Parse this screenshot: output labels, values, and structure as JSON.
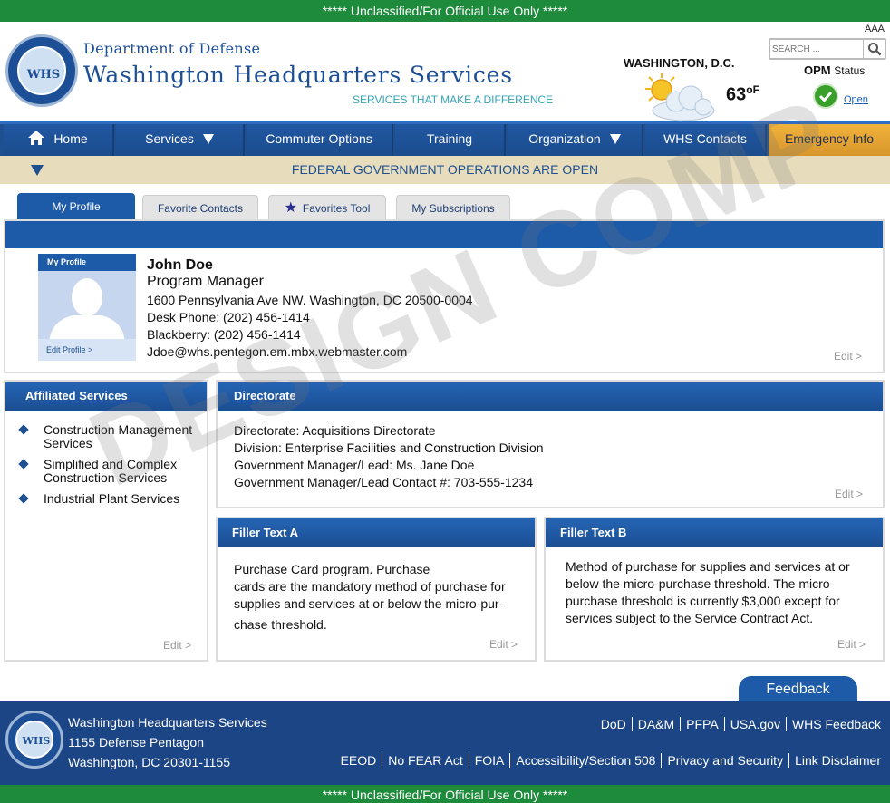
{
  "banner": {
    "top": "***** Unclassified/For Official Use Only *****",
    "bottom": "***** Unclassified/For Official Use Only *****"
  },
  "header": {
    "seal_text": "WHS",
    "dept": "Department of Defense",
    "agency": "Washington Headquarters Services",
    "tagline": "SERVICES THAT MAKE A DIFFERENCE",
    "text_size_label": "AAA",
    "search_placeholder": "SEARCH ...",
    "city": "WASHINGTON, D.C.",
    "temperature": "63",
    "temp_unit": "oF",
    "opm_label": "OPM",
    "opm_status": "Status",
    "opm_open": "Open"
  },
  "nav": {
    "items": [
      {
        "label": "Home"
      },
      {
        "label": "Services"
      },
      {
        "label": "Commuter Options"
      },
      {
        "label": "Training"
      },
      {
        "label": "Organization"
      },
      {
        "label": "WHS Contacts"
      },
      {
        "label": "Emergency Info"
      }
    ]
  },
  "status": {
    "message": "FEDERAL GOVERNMENT OPERATIONS ARE OPEN"
  },
  "tabs": [
    {
      "label": "My Profile"
    },
    {
      "label": "Favorite Contacts"
    },
    {
      "label": "Favorites Tool"
    },
    {
      "label": "My Subscriptions"
    }
  ],
  "profile": {
    "avatar_label": "My Profile",
    "edit_profile": "Edit Profile >",
    "name": "John Doe",
    "title": "Program Manager",
    "address": "1600 Pennsylvania Ave NW. Washington, DC 20500-0004",
    "desk_phone": "Desk Phone: (202) 456-1414",
    "blackberry": "Blackberry: (202) 456-1414",
    "email": "Jdoe@whs.pentegon.em.mbx.webmaster.com",
    "edit": "Edit >"
  },
  "affiliated": {
    "title": "Affiliated Services",
    "items": [
      "Construction Management Services",
      "Simplified and Complex Construction Services",
      "Industrial Plant Services"
    ],
    "edit": "Edit >"
  },
  "directorate": {
    "title": "Directorate",
    "lines": [
      "Directorate: Acquisitions Directorate",
      "Division: Enterprise Facilities and Construction Division",
      "Government Manager/Lead:  Ms. Jane Doe",
      "Government Manager/Lead Contact #: 703-555-1234"
    ],
    "edit": "Edit >"
  },
  "filler_a": {
    "title": "Filler Text A",
    "lines": [
      "Purchase Card program. Purchase",
      "cards are the mandatory method of purchase for",
      "supplies and services at or below the micro-pur-",
      "chase threshold."
    ],
    "edit": "Edit >"
  },
  "filler_b": {
    "title": "Filler Text B",
    "lines": [
      "Method of purchase for supplies and services at or",
      "below the micro-purchase threshold.  The micro-",
      "purchase threshold is currently $3,000 except for",
      "services subject to  the Service Contract Act."
    ],
    "edit": "Edit >"
  },
  "feedback": {
    "label": "Feedback"
  },
  "footer": {
    "seal_text": "WHS",
    "org": "Washington Headquarters Services",
    "street": "1155 Defense Pentagon",
    "city": "Washington, DC 20301-1155",
    "links_row1": [
      "DoD",
      "DA&M",
      "PFPA",
      "USA.gov",
      "WHS Feedback"
    ],
    "links_row2": [
      "EEOD",
      "No FEAR Act",
      "FOIA",
      "Accessibility/Section 508",
      "Privacy and Security",
      "Link Disclaimer"
    ]
  },
  "watermark": "DESIGN COMP",
  "colors": {
    "banner_green": "#1e8a3c",
    "nav_blue": "#1d4f91",
    "emergency_gold": "#e3a033",
    "status_bg": "#e7ddbd"
  }
}
